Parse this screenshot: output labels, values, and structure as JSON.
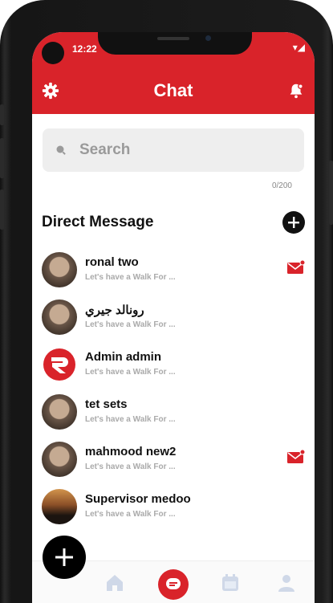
{
  "status_bar": {
    "time": "12:22",
    "icons": "▾◢"
  },
  "header": {
    "title": "Chat"
  },
  "search": {
    "placeholder": "Search",
    "counter": "0/200"
  },
  "section": {
    "title": "Direct Message"
  },
  "conversations": [
    {
      "name": "ronal two",
      "preview": "Let's have a Walk For ...",
      "avatar": "man",
      "unread": true
    },
    {
      "name": "رونالد جيري",
      "preview": "Let's have a Walk For ...",
      "avatar": "man",
      "unread": false
    },
    {
      "name": "Admin admin",
      "preview": "Let's have a Walk For ...",
      "avatar": "logo",
      "unread": false
    },
    {
      "name": "tet sets",
      "preview": "Let's have a Walk For ...",
      "avatar": "man",
      "unread": false
    },
    {
      "name": "mahmood new2",
      "preview": "Let's have a Walk For ...",
      "avatar": "man",
      "unread": true
    },
    {
      "name": "Supervisor medoo",
      "preview": "Let's have a Walk For ...",
      "avatar": "crowd",
      "unread": false
    }
  ],
  "icons": {
    "settings": "gear-icon",
    "notification": "bell-icon",
    "search": "search-icon",
    "new_message": "plus-icon",
    "unread": "mail-icon",
    "nav": [
      "home-icon",
      "chat-icon",
      "calendar-icon",
      "profile-icon"
    ]
  },
  "colors": {
    "primary": "#d9232a",
    "nav_inactive": "#cfd8e8",
    "fab": "#000000"
  }
}
